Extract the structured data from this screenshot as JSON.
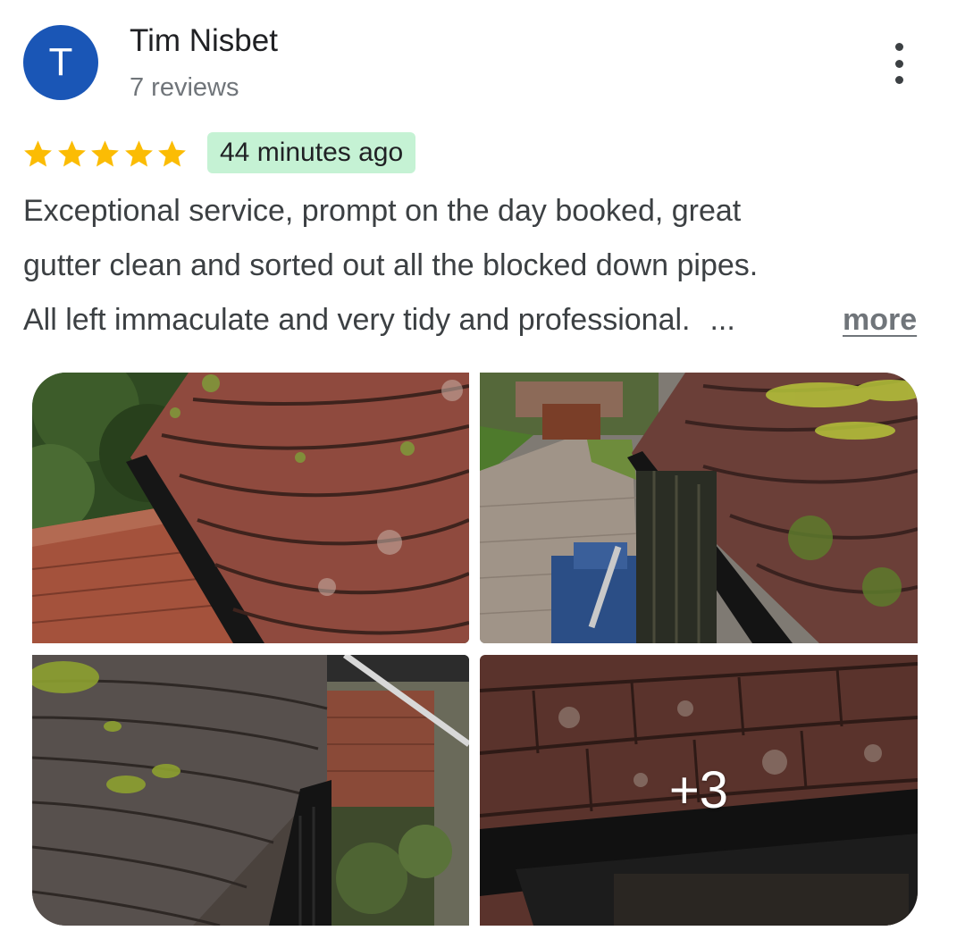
{
  "review": {
    "reviewer": {
      "avatar_letter": "T",
      "avatar_color": "#1a56b6",
      "name": "Tim Nisbet",
      "meta": "7 reviews"
    },
    "menu_icon": "more-vert-icon",
    "rating": 5,
    "rating_max": 5,
    "star_color": "#fbbc04",
    "time_ago": "44 minutes ago",
    "time_badge_color": "#c5f2d4",
    "text_lines": [
      "Exceptional service, prompt on the day booked, great",
      "gutter clean and sorted out all the blocked down pipes.",
      "All left immaculate and very tidy and professional."
    ],
    "ellipsis": "...",
    "more_label": "more",
    "photos": {
      "extra_count_label": "+3"
    }
  }
}
